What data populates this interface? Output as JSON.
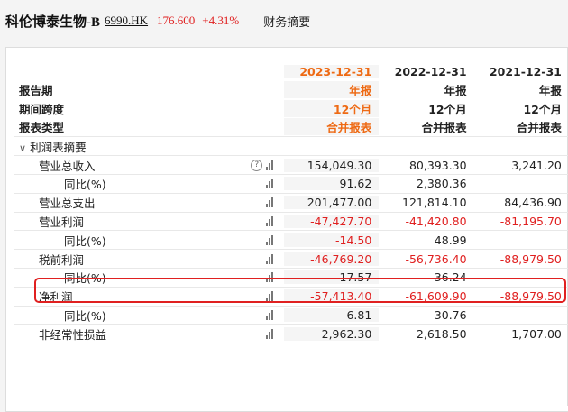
{
  "header": {
    "company": "科伦博泰生物-B",
    "code": "6990.HK",
    "price": "176.600",
    "change": "+4.31%",
    "section": "财务摘要"
  },
  "columns": [
    "2023-12-31",
    "2022-12-31",
    "2021-12-31"
  ],
  "meta_rows": [
    {
      "label": "报告期",
      "values": [
        "年报",
        "年报",
        "年报"
      ]
    },
    {
      "label": "期间跨度",
      "values": [
        "12个月",
        "12个月",
        "12个月"
      ]
    },
    {
      "label": "报表类型",
      "values": [
        "合并报表",
        "合并报表",
        "合并报表"
      ]
    }
  ],
  "group": {
    "label": "利润表摘要"
  },
  "rows": [
    {
      "label": "营业总收入",
      "values": [
        "154,049.30",
        "80,393.30",
        "3,241.20"
      ]
    },
    {
      "label": "同比(%)",
      "values": [
        "91.62",
        "2,380.36",
        ""
      ]
    },
    {
      "label": "营业总支出",
      "values": [
        "201,477.00",
        "121,814.10",
        "84,436.90"
      ]
    },
    {
      "label": "营业利润",
      "values": [
        "-47,427.70",
        "-41,420.80",
        "-81,195.70"
      ]
    },
    {
      "label": "同比(%)",
      "values": [
        "-14.50",
        "48.99",
        ""
      ]
    },
    {
      "label": "税前利润",
      "values": [
        "-46,769.20",
        "-56,736.40",
        "-88,979.50"
      ]
    },
    {
      "label": "同比(%)",
      "values": [
        "17.57",
        "36.24",
        ""
      ]
    },
    {
      "label": "净利润",
      "values": [
        "-57,413.40",
        "-61,609.90",
        "-88,979.50"
      ]
    },
    {
      "label": "同比(%)",
      "values": [
        "6.81",
        "30.76",
        ""
      ]
    },
    {
      "label": "非经常性损益",
      "values": [
        "2,962.30",
        "2,618.50",
        "1,707.00"
      ]
    }
  ],
  "icons": {
    "help": "?"
  }
}
